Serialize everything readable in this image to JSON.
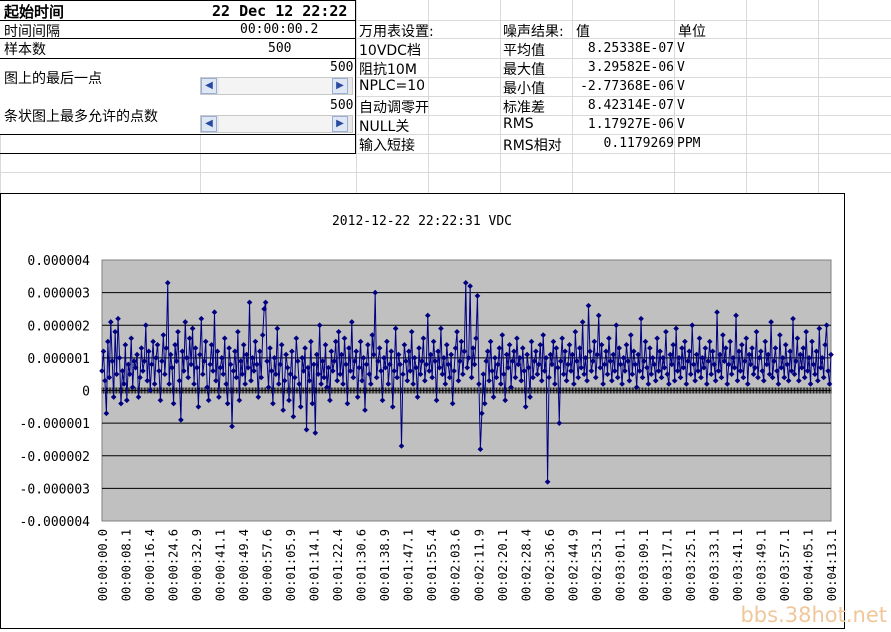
{
  "sheet": {
    "start_time_label": "起始时间",
    "start_time_value": "22 Dec 12 22:22",
    "interval_label": "时间间隔",
    "interval_value": "00:00:00.2",
    "samples_label": "样本数",
    "samples_value": "500",
    "last_point_label": "图上的最后一点",
    "last_point_value": "500",
    "max_points_label": "条状图上最多允许的点数",
    "max_points_value": "500",
    "settings_header": "万用表设置:",
    "settings": [
      "10VDC档",
      "阻抗10M",
      "NPLC=10",
      "自动调零开",
      "NULL关",
      "输入短接"
    ],
    "noise_header": "噪声结果:",
    "value_header": "值",
    "unit_header": "单位",
    "results": [
      {
        "name": "平均值",
        "value": "8.25338E-07",
        "unit": "V"
      },
      {
        "name": "最大值",
        "value": "3.29582E-06",
        "unit": "V"
      },
      {
        "name": "最小值",
        "value": "-2.77368E-06",
        "unit": "V"
      },
      {
        "name": "标准差",
        "value": "8.42314E-07",
        "unit": "V"
      },
      {
        "name": "RMS",
        "value": "1.17927E-06",
        "unit": "V"
      },
      {
        "name": "RMS相对",
        "value": "0.1179269",
        "unit": "PPM"
      }
    ],
    "scroll_left_icon": "arrow-left-icon",
    "scroll_right_icon": "arrow-right-icon"
  },
  "watermark": "bbs.38hot.net",
  "chart_data": {
    "type": "line",
    "title": "2012-12-22  22:22:31  VDC",
    "ylim": [
      -4e-06,
      4e-06
    ],
    "y_ticks": [
      "0.000004",
      "0.000003",
      "0.000002",
      "0.000001",
      "0",
      "-0.000001",
      "-0.000002",
      "-0.000003",
      "-0.000004"
    ],
    "x_tick_labels": [
      "00:00:00.0",
      "00:00:08.1",
      "00:00:16.4",
      "00:00:24.6",
      "00:00:32.9",
      "00:00:41.1",
      "00:00:49.4",
      "00:00:57.6",
      "00:01:05.9",
      "00:01:14.1",
      "00:01:22.4",
      "00:01:30.6",
      "00:01:38.9",
      "00:01:47.1",
      "00:01:55.4",
      "00:02:03.6",
      "00:02:11.9",
      "00:02:20.1",
      "00:02:28.4",
      "00:02:36.6",
      "00:02:44.9",
      "00:02:53.1",
      "00:03:01.1",
      "00:03:09.1",
      "00:03:17.1",
      "00:03:25.1",
      "00:03:33.1",
      "00:03:41.1",
      "00:03:49.1",
      "00:03:57.1",
      "00:04:05.1",
      "00:04:13.1"
    ],
    "grid": true,
    "plot_bg": "#c0c0c0",
    "series_color": "#000080",
    "series": [
      {
        "name": "VDC",
        "values": [
          0.6,
          1.2,
          0.3,
          -0.7,
          1.5,
          0.4,
          2.1,
          0.9,
          -0.2,
          1.8,
          0.5,
          2.2,
          1.0,
          -0.4,
          0.6,
          0.2,
          1.4,
          -0.3,
          0.8,
          0.5,
          1.6,
          0.1,
          0.9,
          0.7,
          1.1,
          -0.2,
          0.4,
          1.3,
          0.6,
          0.9,
          2.0,
          0.3,
          1.2,
          0.0,
          0.8,
          1.5,
          0.2,
          1.0,
          1.4,
          0.6,
          -0.3,
          0.9,
          1.7,
          0.5,
          1.3,
          3.3,
          0.2,
          1.1,
          0.7,
          -0.4,
          1.4,
          0.9,
          1.8,
          0.3,
          -0.9,
          1.2,
          0.6,
          2.1,
          1.0,
          0.4,
          1.6,
          0.8,
          1.9,
          0.2,
          1.3,
          0.7,
          -0.5,
          1.1,
          2.2,
          0.5,
          0.9,
          1.5,
          0.1,
          -0.3,
          0.8,
          1.4,
          0.6,
          2.4,
          0.3,
          1.2,
          -0.2,
          0.7,
          1.0,
          0.5,
          1.6,
          0.2,
          -0.4,
          1.3,
          0.8,
          -1.1,
          0.6,
          1.2,
          0.4,
          1.8,
          -0.3,
          0.9,
          0.5,
          1.4,
          0.2,
          1.1,
          0.7,
          2.7,
          0.3,
          1.0,
          0.6,
          1.5,
          0.8,
          -0.2,
          1.2,
          0.4,
          1.7,
          2.5,
          2.7,
          0.9,
          0.1,
          1.3,
          0.6,
          -0.4,
          1.0,
          0.5,
          1.9,
          0.2,
          0.8,
          1.4,
          -0.6,
          0.3,
          1.1,
          0.7,
          -0.3,
          0.5,
          1.2,
          -0.8,
          0.4,
          1.6,
          0.9,
          0.2,
          -0.5,
          1.0,
          0.6,
          1.3,
          -1.2,
          0.7,
          0.3,
          1.5,
          -0.4,
          0.8,
          -1.3,
          1.1,
          0.5,
          2.0,
          0.2,
          0.9,
          0.4,
          1.4,
          0.1,
          0.7,
          -0.3,
          1.2,
          0.6,
          0.9,
          1.5,
          0.3,
          1.8,
          0.5,
          1.1,
          0.2,
          1.6,
          0.8,
          -0.4,
          1.3,
          0.6,
          2.1,
          0.4,
          0.9,
          1.2,
          -0.2,
          0.7,
          1.5,
          0.3,
          1.0,
          -0.6,
          0.8,
          1.4,
          0.5,
          0.2,
          1.7,
          1.1,
          3.0,
          0.4,
          0.9,
          1.3,
          0.6,
          -0.3,
          1.0,
          0.7,
          1.5,
          0.2,
          0.8,
          1.2,
          -0.5,
          0.6,
          1.9,
          0.4,
          1.1,
          0.8,
          -1.7,
          0.5,
          1.4,
          0.9,
          0.3,
          1.2,
          0.6,
          1.8,
          0.2,
          1.0,
          0.7,
          -0.2,
          1.3,
          0.5,
          0.9,
          1.6,
          0.3,
          0.8,
          2.3,
          0.6,
          1.1,
          0.4,
          1.5,
          0.9,
          -0.3,
          1.2,
          0.7,
          1.9,
          0.5,
          1.0,
          0.2,
          1.4,
          0.8,
          0.4,
          1.1,
          -0.4,
          0.6,
          1.3,
          1.8,
          0.3,
          0.9,
          1.5,
          0.5,
          1.2,
          3.3,
          0.7,
          1.0,
          3.2,
          0.4,
          1.3,
          0.8,
          1.6,
          2.9,
          0.2,
          -1.8,
          -0.7,
          0.5,
          -0.4,
          0.9,
          1.2,
          0.3,
          1.5,
          0.6,
          -0.2,
          1.0,
          0.4,
          0.8,
          1.3,
          0.2,
          1.7,
          0.5,
          -0.3,
          1.1,
          0.7,
          1.4,
          0.1,
          0.9,
          1.2,
          0.4,
          1.6,
          0.8,
          1.0,
          0.3,
          1.3,
          0.6,
          -0.5,
          1.1,
          0.7,
          -0.2,
          1.5,
          0.4,
          0.9,
          1.2,
          0.5,
          0.8,
          1.4,
          0.3,
          1.7,
          0.6,
          1.0,
          -2.8,
          0.4,
          1.1,
          0.8,
          1.5,
          0.2,
          1.3,
          0.7,
          -1.0,
          0.9,
          1.6,
          0.5,
          1.2,
          0.3,
          0.8,
          1.4,
          0.6,
          1.1,
          0.2,
          1.8,
          0.9,
          0.4,
          1.3,
          0.7,
          2.1,
          0.5,
          1.0,
          0.3,
          2.6,
          1.2,
          0.6,
          0.9,
          1.5,
          0.4,
          1.1,
          2.3,
          0.7,
          1.4,
          0.2,
          0.8,
          1.2,
          0.5,
          1.6,
          0.9,
          0.3,
          1.1,
          0.6,
          2.0,
          0.4,
          1.3,
          0.8,
          0.2,
          1.0,
          0.6,
          1.4,
          0.9,
          0.3,
          1.7,
          0.5,
          1.2,
          0.8,
          0.1,
          1.1,
          0.6,
          2.2,
          0.4,
          0.9,
          1.5,
          0.7,
          0.2,
          1.3,
          0.5,
          1.0,
          0.8,
          0.3,
          1.6,
          0.6,
          1.2,
          0.4,
          1.0,
          0.7,
          1.8,
          0.5,
          0.2,
          1.1,
          0.8,
          1.4,
          0.3,
          1.9,
          0.6,
          1.0,
          0.4,
          1.3,
          0.7,
          1.5,
          0.2,
          0.9,
          1.2,
          0.5,
          2.0,
          0.8,
          0.3,
          1.1,
          0.6,
          1.6,
          0.4,
          1.0,
          0.7,
          1.3,
          0.2,
          0.9,
          1.5,
          0.5,
          1.2,
          0.8,
          0.3,
          2.4,
          0.6,
          1.1,
          0.4,
          1.7,
          0.9,
          1.3,
          0.2,
          0.8,
          1.5,
          0.5,
          1.0,
          0.7,
          2.3,
          0.3,
          1.2,
          0.6,
          1.4,
          0.4,
          0.9,
          1.6,
          0.2,
          1.1,
          0.8,
          1.3,
          0.5,
          0.7,
          1.8,
          0.4,
          1.0,
          1.2,
          0.6,
          0.3,
          1.5,
          0.8,
          1.1,
          0.5,
          2.1,
          0.4,
          0.9,
          1.3,
          0.6,
          0.2,
          1.7,
          0.7,
          1.0,
          0.4,
          1.4,
          0.8,
          0.3,
          1.2,
          0.6,
          2.2,
          0.5,
          0.9,
          1.6,
          0.3,
          1.1,
          0.7,
          1.3,
          0.4,
          1.8,
          0.6,
          1.0,
          0.2,
          1.5,
          0.8,
          0.5,
          1.2,
          0.3,
          1.9,
          0.7,
          1.0,
          0.4,
          1.4,
          2.0,
          0.6,
          0.2,
          1.1
        ]
      }
    ]
  }
}
